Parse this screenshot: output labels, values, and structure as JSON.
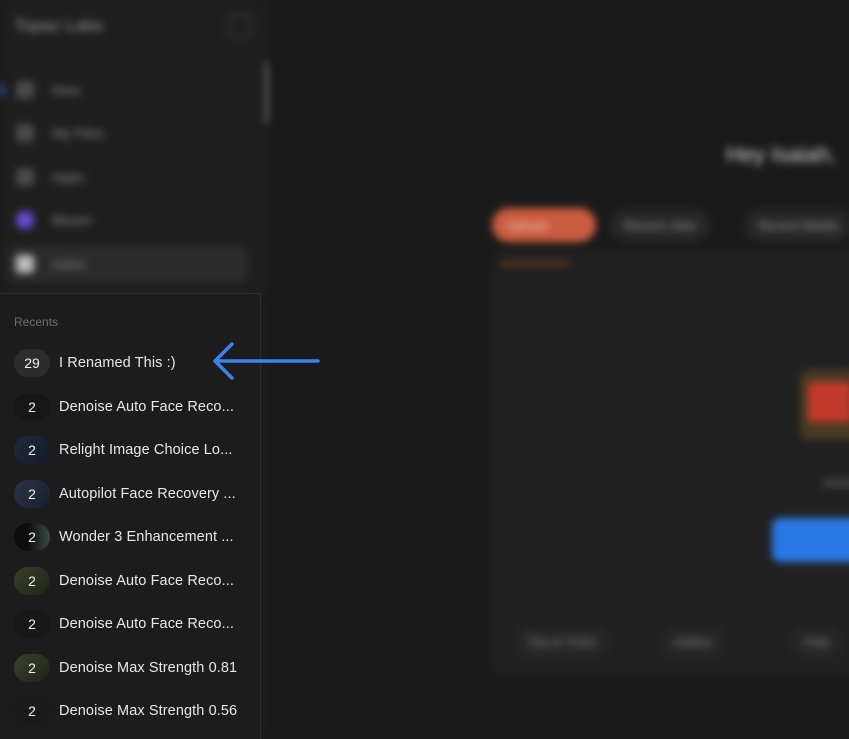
{
  "sidebar": {
    "brand": "Topaz Labs",
    "nav": [
      {
        "label": "New",
        "icon": "plus-icon"
      },
      {
        "label": "My Files",
        "icon": "folder-icon"
      },
      {
        "label": "Apps",
        "icon": "apps-icon"
      },
      {
        "label": "Bloom",
        "icon": "bloom-icon"
      },
      {
        "label": "Astra",
        "icon": "astra-icon"
      }
    ]
  },
  "main": {
    "greeting": "Hey Isaiah,",
    "chips": [
      "Upload",
      "Recent Jobs",
      "Recent Media"
    ],
    "footer_chips": [
      "Tips & Tricks",
      "Gallery",
      "Help"
    ]
  },
  "recents": {
    "heading": "Recents",
    "items": [
      {
        "count": "29",
        "label": "I Renamed This :)"
      },
      {
        "count": "2",
        "label": "Denoise Auto Face Reco..."
      },
      {
        "count": "2",
        "label": "Relight Image Choice Lo..."
      },
      {
        "count": "2",
        "label": "Autopilot Face Recovery ..."
      },
      {
        "count": "2",
        "label": "Wonder 3 Enhancement ..."
      },
      {
        "count": "2",
        "label": "Denoise Auto Face Reco..."
      },
      {
        "count": "2",
        "label": "Denoise Auto Face Reco..."
      },
      {
        "count": "2",
        "label": "Denoise Max Strength 0.81"
      },
      {
        "count": "2",
        "label": "Denoise Max Strength 0.56"
      }
    ]
  },
  "colors": {
    "accent": "#2f7be6",
    "primary_chip": "#c95b3f",
    "background": "#1c1c1c"
  }
}
